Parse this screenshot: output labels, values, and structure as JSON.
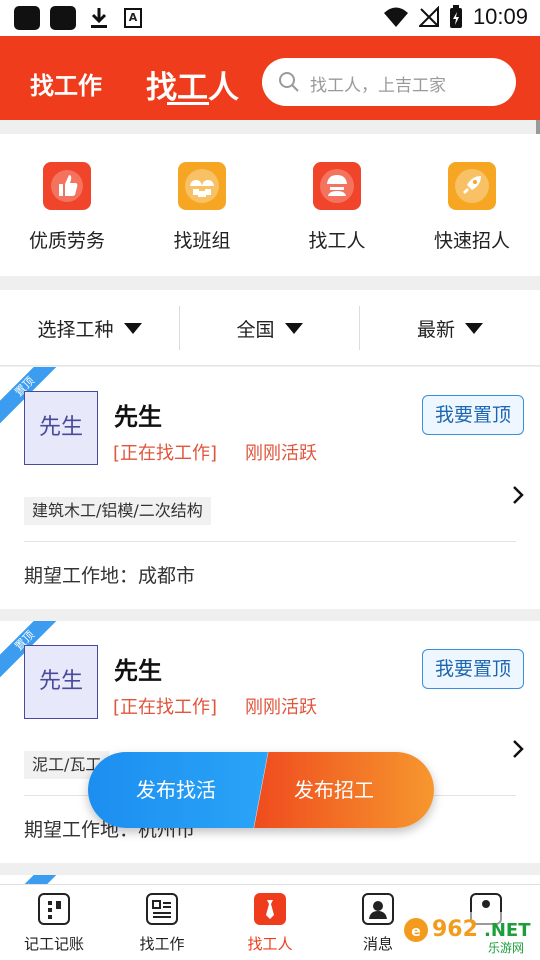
{
  "status_bar": {
    "time": "10:09"
  },
  "header": {
    "tab_work": "找工作",
    "tab_find_workers": "找工人",
    "search_placeholder": "找工人，上吉工家"
  },
  "categories": [
    {
      "label": "优质劳务",
      "icon": "thumbs-up-icon",
      "color": "#f0452a"
    },
    {
      "label": "找班组",
      "icon": "team-icon",
      "color": "#f6a623"
    },
    {
      "label": "找工人",
      "icon": "worker-icon",
      "color": "#f0452a"
    },
    {
      "label": "快速招人",
      "icon": "rocket-icon",
      "color": "#f6a623"
    }
  ],
  "filters": {
    "trade": "选择工种",
    "region": "全国",
    "sort": "最新"
  },
  "cards": [
    {
      "ribbon": "置顶",
      "avatar": "先生",
      "name": "先生",
      "status": "[正在找工作]",
      "active": "刚刚活跃",
      "pin_button": "我要置顶",
      "tag": "建筑木工/铝模/二次结构",
      "location": "期望工作地：成都市"
    },
    {
      "ribbon": "置顶",
      "avatar": "先生",
      "name": "先生",
      "status": "[正在找工作]",
      "active": "刚刚活跃",
      "pin_button": "我要置顶",
      "tag": "泥工/瓦工",
      "location": "期望工作地：杭州市"
    },
    {
      "ribbon": "置顶"
    }
  ],
  "fab": {
    "publish_job": "发布找活",
    "publish_hire": "发布招工"
  },
  "bottom_nav": [
    {
      "label": "记工记账",
      "icon": "ledger-icon"
    },
    {
      "label": "找工作",
      "icon": "resume-icon"
    },
    {
      "label": "找工人",
      "icon": "tie-icon"
    },
    {
      "label": "消息",
      "icon": "message-icon"
    },
    {
      "label": "",
      "icon": "profile-icon"
    }
  ],
  "watermark": {
    "text": "962.NET",
    "subtext": "乐游网"
  },
  "colors": {
    "brand_red": "#ee3c1c",
    "blue": "#1c8ef0",
    "orange": "#f6972e"
  }
}
